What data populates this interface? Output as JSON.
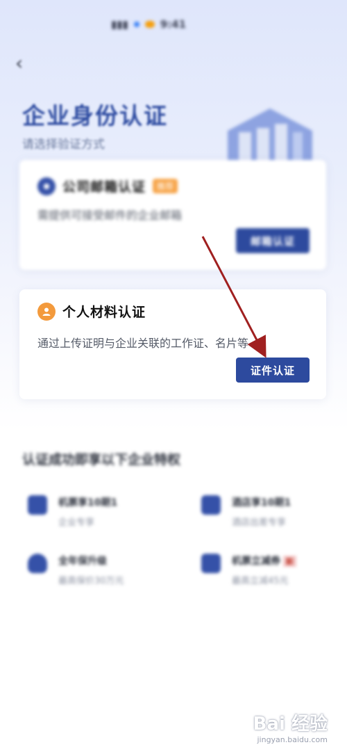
{
  "status_bar": {
    "time": "9:41",
    "icons": [
      "signal-icon",
      "wifi-icon",
      "battery-icon"
    ]
  },
  "header": {
    "back_icon": "back-arrow-icon"
  },
  "page": {
    "title": "企业身份认证",
    "subtitle": "请选择验证方式"
  },
  "cards": [
    {
      "title": "公司邮箱认证",
      "tag": "推荐",
      "description": "需提供可接受邮件的企业邮箱",
      "button": "邮箱认证",
      "icon": "mail-icon"
    },
    {
      "title": "个人材料认证",
      "description": "通过上传证明与企业关联的工作证、名片等",
      "button": "证件认证",
      "icon": "person-icon"
    }
  ],
  "benefits": {
    "title": "认证成功即享以下企业特权",
    "items": [
      {
        "name": "机票享10期1",
        "desc": "企业专享",
        "icon": "plane-icon"
      },
      {
        "name": "酒店享10期1",
        "desc": "酒店出差专享",
        "icon": "hotel-icon"
      },
      {
        "name": "全年保升级",
        "desc": "最高保价30万元",
        "icon": "shield-icon"
      },
      {
        "name": "机票立减券",
        "desc": "最高立减45元",
        "tag": "新",
        "icon": "ticket-icon"
      }
    ]
  },
  "watermark": {
    "main": "Bai 经验",
    "sub": "jingyan.baidu.com"
  },
  "colors": {
    "brand": "#2d4a9e",
    "title": "#2c4aa0",
    "tag": "#f7a54a",
    "annotation": "#a02020"
  }
}
